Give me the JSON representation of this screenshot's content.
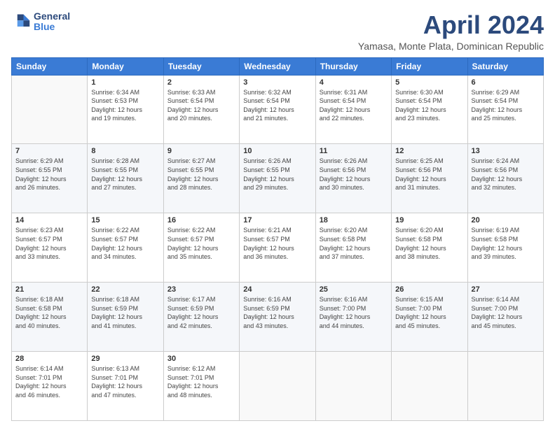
{
  "header": {
    "logo_line1": "General",
    "logo_line2": "Blue",
    "month_title": "April 2024",
    "subtitle": "Yamasa, Monte Plata, Dominican Republic"
  },
  "weekdays": [
    "Sunday",
    "Monday",
    "Tuesday",
    "Wednesday",
    "Thursday",
    "Friday",
    "Saturday"
  ],
  "rows": [
    [
      {
        "day": "",
        "info": ""
      },
      {
        "day": "1",
        "info": "Sunrise: 6:34 AM\nSunset: 6:53 PM\nDaylight: 12 hours\nand 19 minutes."
      },
      {
        "day": "2",
        "info": "Sunrise: 6:33 AM\nSunset: 6:54 PM\nDaylight: 12 hours\nand 20 minutes."
      },
      {
        "day": "3",
        "info": "Sunrise: 6:32 AM\nSunset: 6:54 PM\nDaylight: 12 hours\nand 21 minutes."
      },
      {
        "day": "4",
        "info": "Sunrise: 6:31 AM\nSunset: 6:54 PM\nDaylight: 12 hours\nand 22 minutes."
      },
      {
        "day": "5",
        "info": "Sunrise: 6:30 AM\nSunset: 6:54 PM\nDaylight: 12 hours\nand 23 minutes."
      },
      {
        "day": "6",
        "info": "Sunrise: 6:29 AM\nSunset: 6:54 PM\nDaylight: 12 hours\nand 25 minutes."
      }
    ],
    [
      {
        "day": "7",
        "info": "Sunrise: 6:29 AM\nSunset: 6:55 PM\nDaylight: 12 hours\nand 26 minutes."
      },
      {
        "day": "8",
        "info": "Sunrise: 6:28 AM\nSunset: 6:55 PM\nDaylight: 12 hours\nand 27 minutes."
      },
      {
        "day": "9",
        "info": "Sunrise: 6:27 AM\nSunset: 6:55 PM\nDaylight: 12 hours\nand 28 minutes."
      },
      {
        "day": "10",
        "info": "Sunrise: 6:26 AM\nSunset: 6:55 PM\nDaylight: 12 hours\nand 29 minutes."
      },
      {
        "day": "11",
        "info": "Sunrise: 6:26 AM\nSunset: 6:56 PM\nDaylight: 12 hours\nand 30 minutes."
      },
      {
        "day": "12",
        "info": "Sunrise: 6:25 AM\nSunset: 6:56 PM\nDaylight: 12 hours\nand 31 minutes."
      },
      {
        "day": "13",
        "info": "Sunrise: 6:24 AM\nSunset: 6:56 PM\nDaylight: 12 hours\nand 32 minutes."
      }
    ],
    [
      {
        "day": "14",
        "info": "Sunrise: 6:23 AM\nSunset: 6:57 PM\nDaylight: 12 hours\nand 33 minutes."
      },
      {
        "day": "15",
        "info": "Sunrise: 6:22 AM\nSunset: 6:57 PM\nDaylight: 12 hours\nand 34 minutes."
      },
      {
        "day": "16",
        "info": "Sunrise: 6:22 AM\nSunset: 6:57 PM\nDaylight: 12 hours\nand 35 minutes."
      },
      {
        "day": "17",
        "info": "Sunrise: 6:21 AM\nSunset: 6:57 PM\nDaylight: 12 hours\nand 36 minutes."
      },
      {
        "day": "18",
        "info": "Sunrise: 6:20 AM\nSunset: 6:58 PM\nDaylight: 12 hours\nand 37 minutes."
      },
      {
        "day": "19",
        "info": "Sunrise: 6:20 AM\nSunset: 6:58 PM\nDaylight: 12 hours\nand 38 minutes."
      },
      {
        "day": "20",
        "info": "Sunrise: 6:19 AM\nSunset: 6:58 PM\nDaylight: 12 hours\nand 39 minutes."
      }
    ],
    [
      {
        "day": "21",
        "info": "Sunrise: 6:18 AM\nSunset: 6:58 PM\nDaylight: 12 hours\nand 40 minutes."
      },
      {
        "day": "22",
        "info": "Sunrise: 6:18 AM\nSunset: 6:59 PM\nDaylight: 12 hours\nand 41 minutes."
      },
      {
        "day": "23",
        "info": "Sunrise: 6:17 AM\nSunset: 6:59 PM\nDaylight: 12 hours\nand 42 minutes."
      },
      {
        "day": "24",
        "info": "Sunrise: 6:16 AM\nSunset: 6:59 PM\nDaylight: 12 hours\nand 43 minutes."
      },
      {
        "day": "25",
        "info": "Sunrise: 6:16 AM\nSunset: 7:00 PM\nDaylight: 12 hours\nand 44 minutes."
      },
      {
        "day": "26",
        "info": "Sunrise: 6:15 AM\nSunset: 7:00 PM\nDaylight: 12 hours\nand 45 minutes."
      },
      {
        "day": "27",
        "info": "Sunrise: 6:14 AM\nSunset: 7:00 PM\nDaylight: 12 hours\nand 45 minutes."
      }
    ],
    [
      {
        "day": "28",
        "info": "Sunrise: 6:14 AM\nSunset: 7:01 PM\nDaylight: 12 hours\nand 46 minutes."
      },
      {
        "day": "29",
        "info": "Sunrise: 6:13 AM\nSunset: 7:01 PM\nDaylight: 12 hours\nand 47 minutes."
      },
      {
        "day": "30",
        "info": "Sunrise: 6:12 AM\nSunset: 7:01 PM\nDaylight: 12 hours\nand 48 minutes."
      },
      {
        "day": "",
        "info": ""
      },
      {
        "day": "",
        "info": ""
      },
      {
        "day": "",
        "info": ""
      },
      {
        "day": "",
        "info": ""
      }
    ]
  ]
}
